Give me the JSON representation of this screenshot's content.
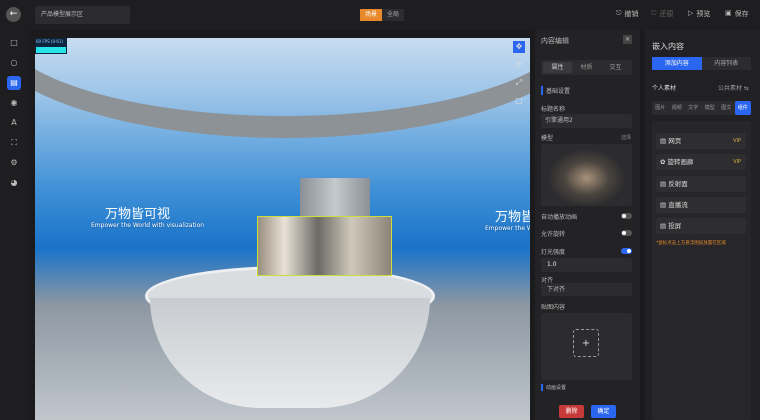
{
  "topbar": {
    "title": "产品模型展示区",
    "modes": [
      "场景",
      "全局"
    ],
    "active_mode": 0,
    "actions": [
      {
        "icon": "undo-icon",
        "label": "撤销"
      },
      {
        "icon": "redo-icon",
        "label": "还原"
      },
      {
        "icon": "preview-icon",
        "label": "预览"
      },
      {
        "icon": "save-icon",
        "label": "保存"
      }
    ]
  },
  "sidebar": {
    "icons": [
      "screen-icon",
      "circle-icon",
      "document-icon",
      "mask-icon",
      "text-icon",
      "focus-icon",
      "gear-icon",
      "globe-icon"
    ],
    "active": 2
  },
  "viewport": {
    "fps": "60 FPS (0-61)",
    "banner_title": "万物皆可视",
    "banner_subtitle": "Empower the World with visualization",
    "tools": [
      "move-icon",
      "rotate-icon",
      "scale-icon",
      "square-icon"
    ]
  },
  "edit_panel": {
    "title": "内容编辑",
    "tabs": [
      "属性",
      "材质",
      "交互"
    ],
    "active_tab": 0,
    "section": "基础设置",
    "name_label": "标题名称",
    "name_value": "引擎通用2",
    "model_label": "模型",
    "model_action": "选择",
    "autoplay_label": "自动播放动画",
    "autoplay": false,
    "rotate_label": "允许旋转",
    "rotate": false,
    "light_label": "灯光强度",
    "light": true,
    "light_value": "1.0",
    "align_label": "对齐",
    "align_value": "下对齐",
    "sticker_label": "贴图内容",
    "anim_section": "动画设置",
    "delete": "删除",
    "confirm": "确定"
  },
  "embed_panel": {
    "title": "嵌入内容",
    "tabs": [
      "添加内容",
      "内容列表"
    ],
    "active_tab": 0,
    "personal": "个人素材",
    "public": "公共素材",
    "categories": [
      "图片",
      "视频",
      "文字",
      "模型",
      "图文",
      "组件"
    ],
    "active_category": 5,
    "items": [
      {
        "label": "网页",
        "icon": "webpage-icon",
        "vip": "VIP"
      },
      {
        "label": "旋转画廊",
        "icon": "gallery-icon",
        "vip": "VIP"
      },
      {
        "label": "反射面",
        "icon": "reflect-icon",
        "vip": ""
      },
      {
        "label": "直播流",
        "icon": "live-icon",
        "vip": ""
      },
      {
        "label": "投屏",
        "icon": "cast-icon",
        "vip": ""
      }
    ],
    "note": "*鼠标点击上方悬浮图层放置在区域"
  },
  "colors": {
    "accent": "#2a66f0",
    "orange": "#e8892b",
    "danger": "#c83a3a"
  }
}
